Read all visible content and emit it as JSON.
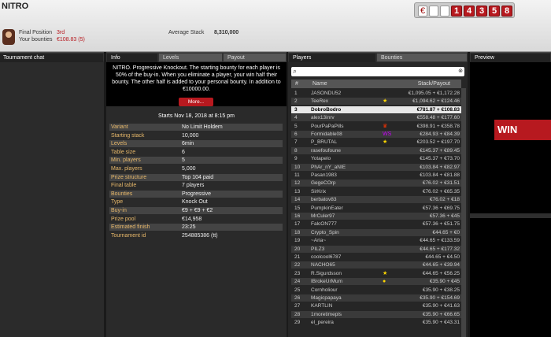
{
  "header": {
    "title": "NITRO",
    "final_position_label": "Final Position",
    "final_position_value": "3rd",
    "bounties_label": "Your bounties",
    "bounties_value": "€108.83 (5)",
    "avg_stack_label": "Average Stack",
    "avg_stack_value": "8,310,000",
    "counter_digits": [
      "1",
      "4",
      "3",
      "5",
      "8"
    ],
    "currency": "€"
  },
  "left_panel": {
    "tab": "Tournament chat"
  },
  "info_panel": {
    "tabs": [
      {
        "label": "Info"
      },
      {
        "label": "Levels"
      },
      {
        "label": "Payout"
      }
    ],
    "description": "NITRO. Progressive Knockout. The starting bounty for each player is 50% of the buy-in. When you eliminate a player, your win half their bounty. The other half is added to your personal bounty. In addition to €10000.00.",
    "more_label": "More...",
    "starts": "Starts Nov 18, 2018 at 8:15 pm",
    "rows": [
      {
        "k": "Variant",
        "v": "No Limit Holdem"
      },
      {
        "k": "Starting stack",
        "v": "10,000"
      },
      {
        "k": "Levels",
        "v": "6min"
      },
      {
        "k": "Table size",
        "v": "6"
      },
      {
        "k": "Min. players",
        "v": "5"
      },
      {
        "k": "Max. players",
        "v": "5,000"
      },
      {
        "k": "Prize structure",
        "v": "Top 104 paid"
      },
      {
        "k": "Final table",
        "v": "7 players"
      },
      {
        "k": "Bounties",
        "v": "Progressive"
      },
      {
        "k": "Type",
        "v": "Knock Out"
      },
      {
        "k": "Buy-in",
        "v": "€9 + €9 + €2"
      },
      {
        "k": "Prize pool",
        "v": "€14,958"
      },
      {
        "k": "Estimated finish",
        "v": "23:25"
      },
      {
        "k": "Tournament id",
        "v": "254885386 (tt)"
      }
    ]
  },
  "players_panel": {
    "tabs": [
      {
        "label": "Players"
      },
      {
        "label": "Bounties"
      }
    ],
    "columns": {
      "rank": "#",
      "name": "Name",
      "stack": "Stack/Payout"
    },
    "rows": [
      {
        "r": "1",
        "n": "JASONDU52",
        "s": "€1,095.05 + €1,172.28",
        "i": ""
      },
      {
        "r": "2",
        "n": "TeeRex",
        "s": "€1,094.62 + €124.46",
        "i": "★"
      },
      {
        "r": "3",
        "n": "DobroBodro",
        "s": "€781.87 + €108.83",
        "i": ""
      },
      {
        "r": "4",
        "n": "alex13inrv",
        "s": "€558.48 + €177.60",
        "i": ""
      },
      {
        "r": "5",
        "n": "PourPaPaPills",
        "s": "€398.91 + €358.78",
        "i": "♛"
      },
      {
        "r": "6",
        "n": "Formidable08",
        "s": "€284.93 + €84.39",
        "i": "WS"
      },
      {
        "r": "7",
        "n": "P_BRUTAL",
        "s": "€203.52 + €197.70",
        "i": "★"
      },
      {
        "r": "8",
        "n": "rasefoufoune",
        "s": "€145.37 + €89.45",
        "i": ""
      },
      {
        "r": "9",
        "n": "Yotapelo",
        "s": "€145.37 + €73.70",
        "i": ""
      },
      {
        "r": "10",
        "n": "PhAr_nY_aNIE",
        "s": "€103.84 + €82.97",
        "i": ""
      },
      {
        "r": "11",
        "n": "Pasan1983",
        "s": "€103.84 + €81.88",
        "i": ""
      },
      {
        "r": "12",
        "n": "GegeCOrp",
        "s": "€76.02 + €31.51",
        "i": ""
      },
      {
        "r": "13",
        "n": "SirKrix",
        "s": "€76.02 + €65.35",
        "i": ""
      },
      {
        "r": "14",
        "n": "berbatov83",
        "s": "€76.02 + €18",
        "i": ""
      },
      {
        "r": "15",
        "n": "PumpkinEater",
        "s": "€57.36 + €69.75",
        "i": ""
      },
      {
        "r": "16",
        "n": "MrCuler97",
        "s": "€57.36 + €45",
        "i": ""
      },
      {
        "r": "17",
        "n": "FalcON777",
        "s": "€57.36 + €51.75",
        "i": ""
      },
      {
        "r": "18",
        "n": "Crypto_Spin",
        "s": "€44.65 + €0",
        "i": ""
      },
      {
        "r": "19",
        "n": "~Aria~",
        "s": "€44.65 + €133.59",
        "i": ""
      },
      {
        "r": "20",
        "n": "PILZ3",
        "s": "€44.65 + €177.32",
        "i": ""
      },
      {
        "r": "21",
        "n": "coolcool6787",
        "s": "€44.65 + €4.50",
        "i": ""
      },
      {
        "r": "22",
        "n": "NACHO65",
        "s": "€44.65 + €39.94",
        "i": ""
      },
      {
        "r": "23",
        "n": "R.Sigurdsson",
        "s": "€44.65 + €56.25",
        "i": "★"
      },
      {
        "r": "24",
        "n": "IBrokeUrMum",
        "s": "€35.90 + €45",
        "i": "●"
      },
      {
        "r": "25",
        "n": "Cornholiour",
        "s": "€35.90 + €38.25",
        "i": ""
      },
      {
        "r": "26",
        "n": "Magicpapaya",
        "s": "€35.90 + €154.69",
        "i": ""
      },
      {
        "r": "27",
        "n": "KARTLIN",
        "s": "€35.90 + €41.63",
        "i": ""
      },
      {
        "r": "28",
        "n": "1moretimepls",
        "s": "€35.90 + €66.65",
        "i": ""
      },
      {
        "r": "29",
        "n": "el_pereira",
        "s": "€35.90 + €43.31",
        "i": ""
      }
    ]
  },
  "preview_panel": {
    "tab": "Preview",
    "logo": "WIN"
  },
  "colors": {
    "accent": "#b7191f",
    "gold": "#e7b86a"
  }
}
